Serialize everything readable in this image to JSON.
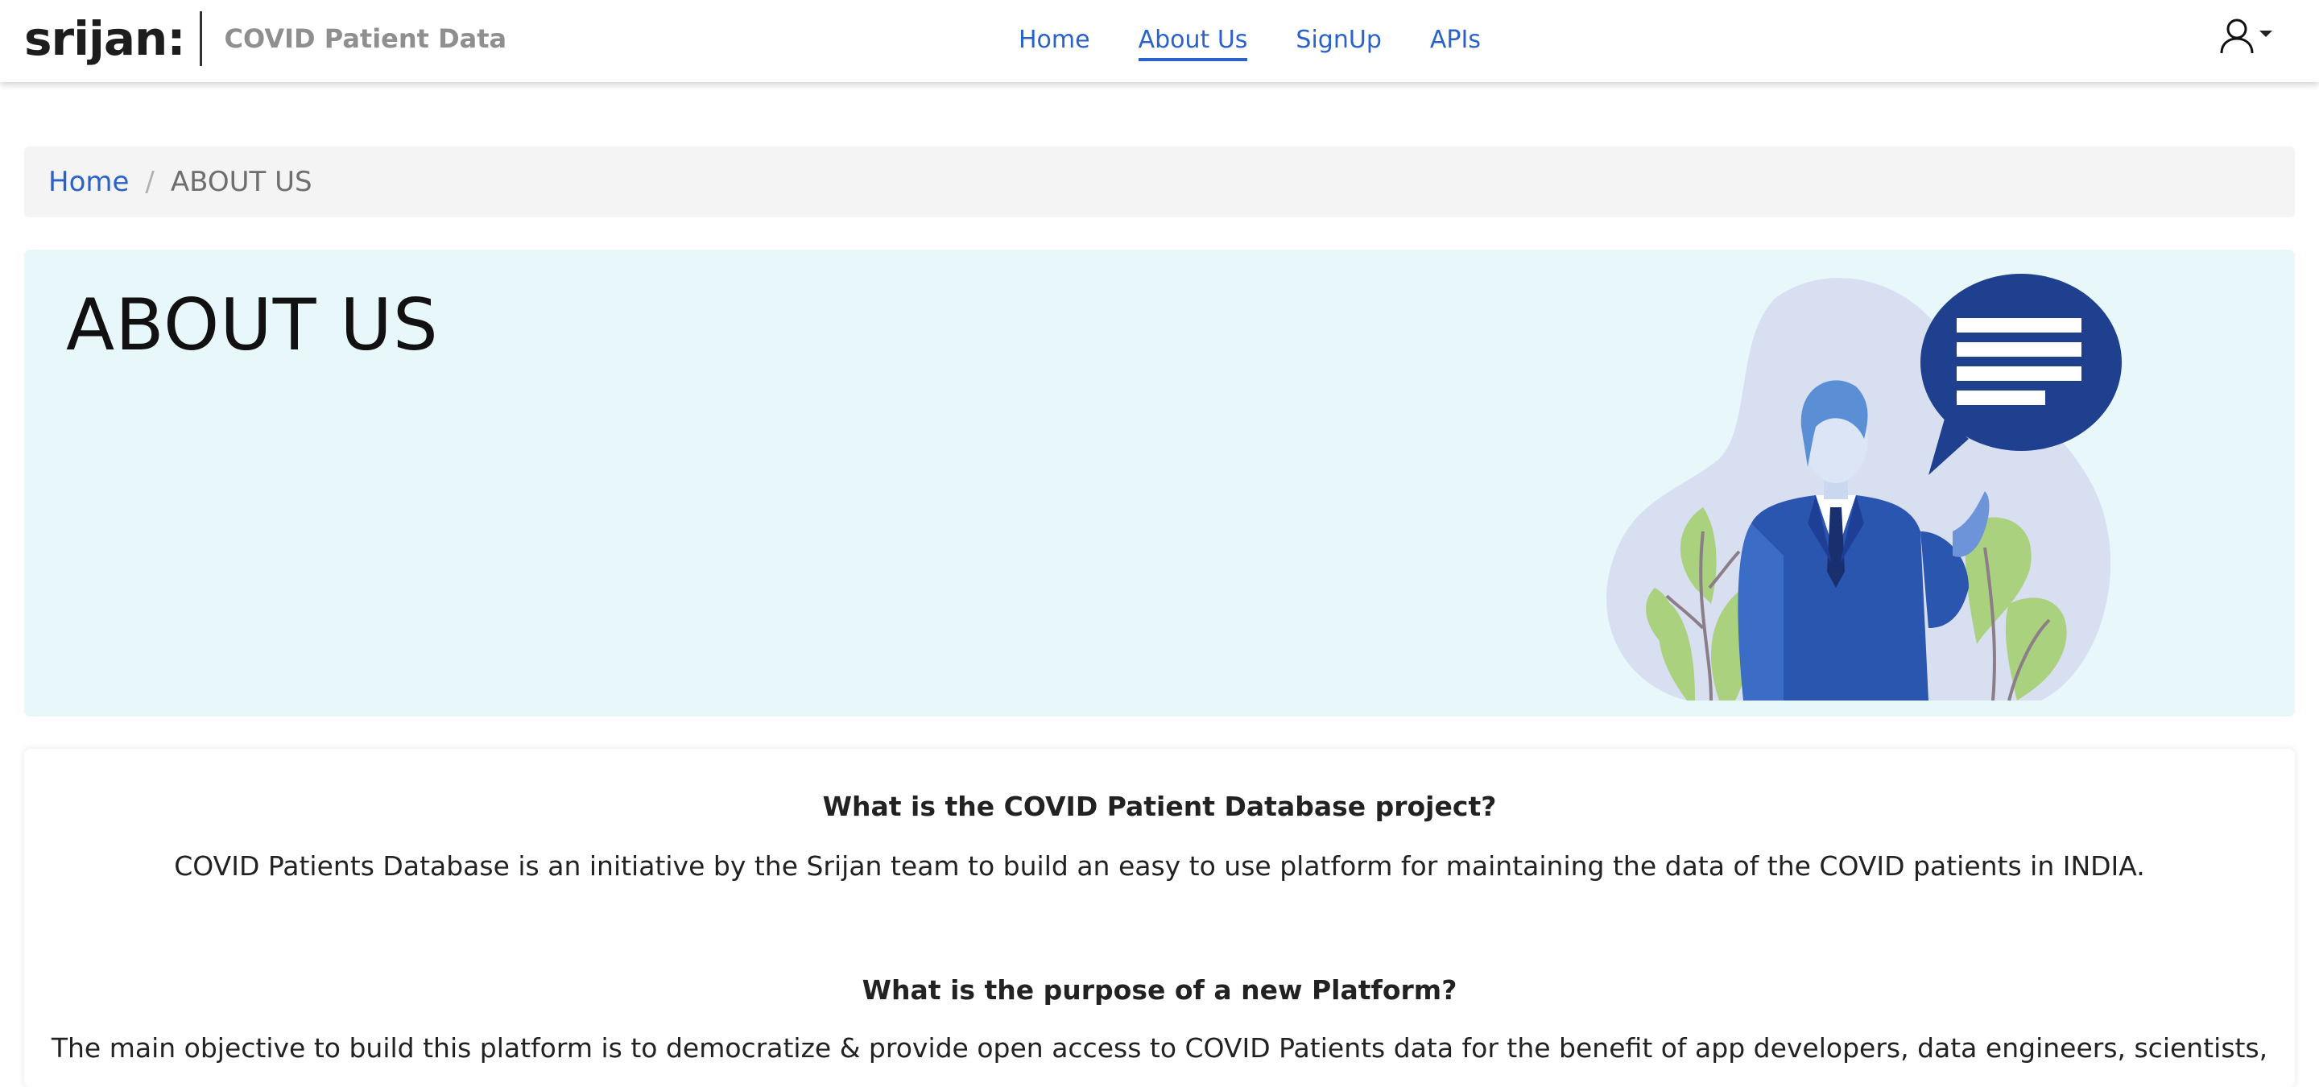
{
  "header": {
    "logo_text": "srijan:",
    "app_title": "COVID Patient Data",
    "nav": [
      {
        "label": "Home"
      },
      {
        "label": "About Us",
        "active": true
      },
      {
        "label": "SignUp"
      },
      {
        "label": "APIs"
      }
    ],
    "user_icon": "user-icon"
  },
  "breadcrumb": {
    "home": "Home",
    "separator": "/",
    "current": "ABOUT US"
  },
  "hero": {
    "title": "ABOUT US",
    "illustration": "businessman-with-speech-bubble"
  },
  "faq": [
    {
      "question": "What is the COVID Patient Database project?",
      "answer": "COVID Patients Database is an initiative by the Srijan team to build an easy to use platform for maintaining the data of the COVID patients in INDIA."
    },
    {
      "question": "What is the purpose of a new Platform?",
      "answer": "The main objective to build this platform is to democratize & provide open access to COVID Patients data for the benefit of app developers, data engineers, scientists,"
    }
  ],
  "colors": {
    "link": "#2a62c9",
    "hero_bg": "#e7f7fa",
    "breadcrumb_bg": "#f4f4f4",
    "brand_sub": "#8f8f8f"
  }
}
